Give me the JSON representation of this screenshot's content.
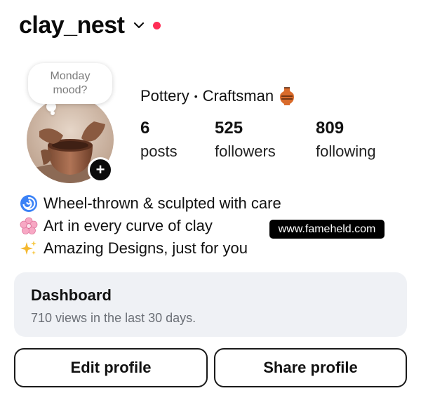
{
  "profile": {
    "username": "clay_nest",
    "note_line1": "Monday",
    "note_line2": "mood?",
    "category_left": "Pottery",
    "category_sep": "•",
    "category_right": "Craftsman"
  },
  "stats": {
    "posts_count": "6",
    "posts_label": "posts",
    "followers_count": "525",
    "followers_label": "followers",
    "following_count": "809",
    "following_label": "following"
  },
  "bio": [
    {
      "icon": "cyclone-icon",
      "text": "Wheel-thrown & sculpted with care"
    },
    {
      "icon": "cherry-blossom-icon",
      "text": "Art in every curve of clay"
    },
    {
      "icon": "sparkles-icon",
      "text": "Amazing Designs, just for you"
    }
  ],
  "watermark": "www.fameheld.com",
  "dashboard": {
    "title": "Dashboard",
    "subtitle": "710 views in the last 30 days."
  },
  "buttons": {
    "edit_label": "Edit profile",
    "share_label": "Share profile"
  },
  "colors": {
    "notification_dot": "#ff2d55",
    "dashboard_bg": "#eff1f5",
    "text_primary": "#111111",
    "text_secondary": "#6b6f76"
  }
}
